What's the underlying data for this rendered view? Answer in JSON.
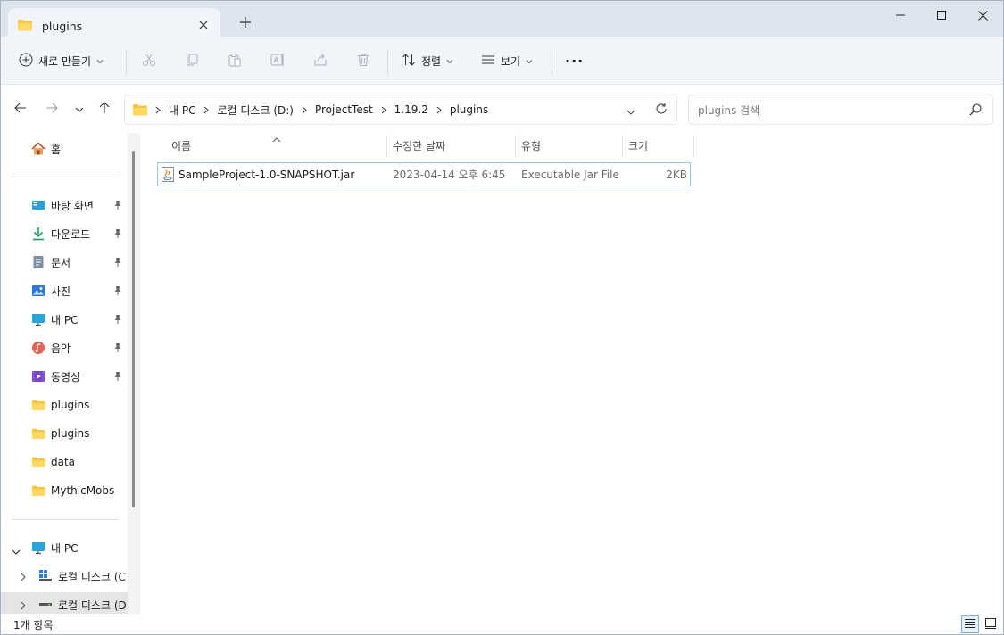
{
  "window": {
    "tab_title": "plugins",
    "new_tab": "+"
  },
  "toolbar": {
    "new_label": "새로 만들기",
    "sort_label": "정렬",
    "view_label": "보기",
    "more_label": "···"
  },
  "address": {
    "crumbs": [
      "내 PC",
      "로컬 디스크 (D:)",
      "ProjectTest",
      "1.19.2",
      "plugins"
    ],
    "search_placeholder": "plugins 검색"
  },
  "sidebar": {
    "home": "홈",
    "quick": [
      {
        "label": "바탕 화면",
        "icon": "desktop-icon"
      },
      {
        "label": "다운로드",
        "icon": "download-icon"
      },
      {
        "label": "문서",
        "icon": "document-icon"
      },
      {
        "label": "사진",
        "icon": "pictures-icon"
      },
      {
        "label": "내 PC",
        "icon": "pc-icon"
      },
      {
        "label": "음악",
        "icon": "music-icon"
      },
      {
        "label": "동영상",
        "icon": "video-icon"
      }
    ],
    "folders": [
      "plugins",
      "plugins",
      "data",
      "MythicMobs"
    ],
    "thispc": "내 PC",
    "drives": [
      "로컬 디스크 (C",
      "로컬 디스크 (D"
    ]
  },
  "columns": {
    "name": "이름",
    "modified": "수정한 날짜",
    "type": "유형",
    "size": "크기"
  },
  "files": [
    {
      "name": "SampleProject-1.0-SNAPSHOT.jar",
      "modified": "2023-04-14 오후 6:45",
      "type": "Executable Jar File",
      "size": "2KB",
      "icon": "jar-file-icon"
    }
  ],
  "status": {
    "count": "1개 항목"
  },
  "colors": {
    "titlebar": "#dde5ee",
    "toolbar": "#f1f5f9",
    "folder": "#f5c542",
    "selection_border": "#99c9ea"
  }
}
